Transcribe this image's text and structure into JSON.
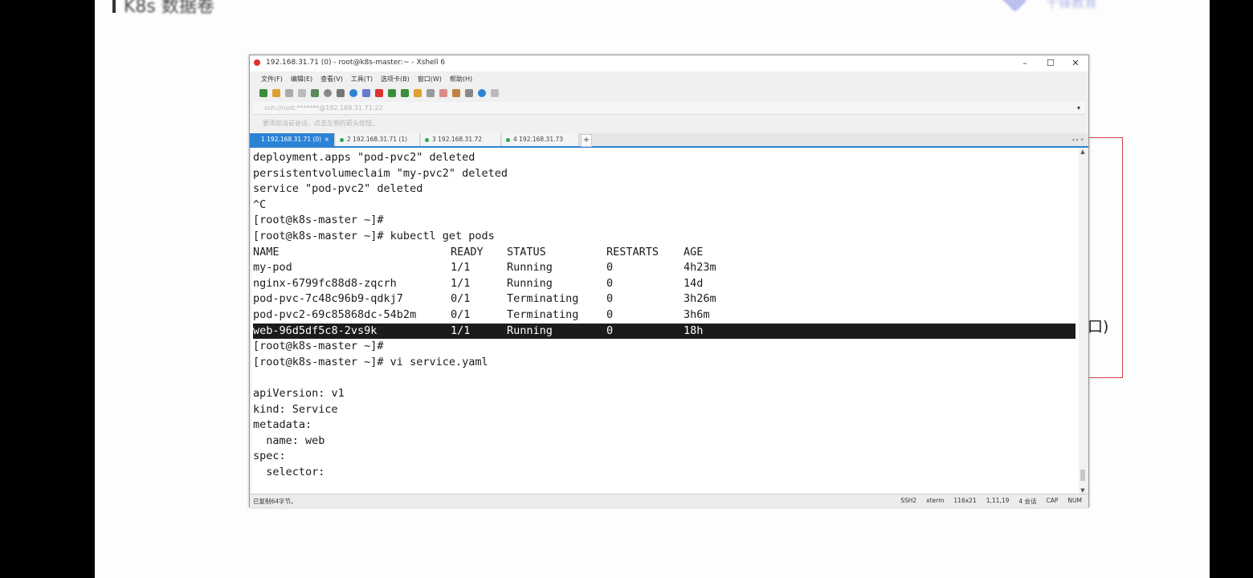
{
  "slide": {
    "title": "K8s 数据卷",
    "brand": "千锋教育"
  },
  "diagram": {
    "text": "口)"
  },
  "window": {
    "title": "192.168.31.71 (0) - root@k8s-master:~ - Xshell 6",
    "minimize": "–",
    "maximize": "☐",
    "close": "✕"
  },
  "menu": [
    "文件(F)",
    "编辑(E)",
    "查看(V)",
    "工具(T)",
    "选项卡(B)",
    "窗口(W)",
    "帮助(H)"
  ],
  "address": {
    "text": "ssh://root:*******@192.168.31.71:22",
    "dropdown": "▾"
  },
  "hint": "要添加当前会话，点击左侧的箭头按钮。",
  "tabs": [
    {
      "label": "1 192.168.31.71 (0)",
      "active": true
    },
    {
      "label": "2 192.168.31.71 (1)",
      "active": false
    },
    {
      "label": "3 192.168.31.72",
      "active": false
    },
    {
      "label": "4 192.168.31.73",
      "active": false
    }
  ],
  "tab_add": "+",
  "terminal": {
    "lines": [
      "deployment.apps \"pod-pvc2\" deleted",
      "persistentvolumeclaim \"my-pvc2\" deleted",
      "service \"pod-pvc2\" deleted",
      "^C",
      "[root@k8s-master ~]#",
      "[root@k8s-master ~]# kubectl get pods"
    ],
    "pods_header": [
      "NAME",
      "READY",
      "STATUS",
      "RESTARTS",
      "AGE"
    ],
    "pods": [
      {
        "name": "my-pod",
        "ready": "1/1",
        "status": "Running",
        "restarts": "0",
        "age": "4h23m"
      },
      {
        "name": "nginx-6799fc88d8-zqcrh",
        "ready": "1/1",
        "status": "Running",
        "restarts": "0",
        "age": "14d"
      },
      {
        "name": "pod-pvc-7c48c96b9-qdkj7",
        "ready": "0/1",
        "status": "Terminating",
        "restarts": "0",
        "age": "3h26m"
      },
      {
        "name": "pod-pvc2-69c85868dc-54b2m",
        "ready": "0/1",
        "status": "Terminating",
        "restarts": "0",
        "age": "3h6m"
      },
      {
        "name": "web-96d5df5c8-2vs9k",
        "ready": "1/1",
        "status": "Running",
        "restarts": "0",
        "age": "18h"
      }
    ],
    "after": [
      "[root@k8s-master ~]#",
      "[root@k8s-master ~]# vi service.yaml",
      "",
      "apiVersion: v1",
      "kind: Service",
      "metadata:",
      "  name: web",
      "spec:",
      "  selector:"
    ]
  },
  "status": {
    "left": "已复制64字节。",
    "protocol": "SSH2",
    "term": "xterm",
    "size": "116x21",
    "cursor": "1,11,19",
    "sessions": "4 会话",
    "caps": "CAP",
    "num": "NUM"
  },
  "colors": {
    "accent": "#2b83d6",
    "selection": "#1b1b1b",
    "highlight": "#3d8fd8",
    "diagram_border": "#cc4444"
  }
}
